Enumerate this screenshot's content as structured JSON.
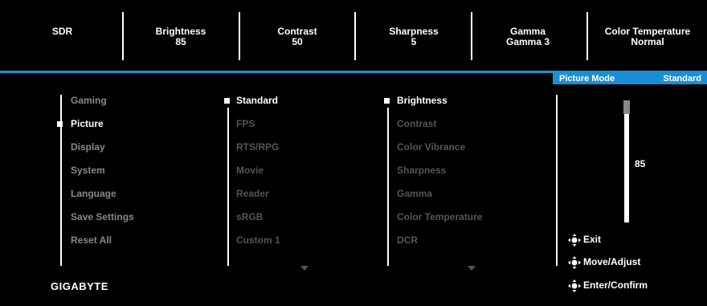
{
  "status_bar": {
    "sdr": "SDR",
    "brightness": {
      "label": "Brightness",
      "value": "85"
    },
    "contrast": {
      "label": "Contrast",
      "value": "50"
    },
    "sharpness": {
      "label": "Sharpness",
      "value": "5"
    },
    "gamma": {
      "label": "Gamma",
      "value": "Gamma 3"
    },
    "color_temp": {
      "label": "Color Temperature",
      "value": "Normal"
    }
  },
  "picture_mode": {
    "label": "Picture Mode",
    "value": "Standard"
  },
  "main_menu": [
    "Gaming",
    "Picture",
    "Display",
    "System",
    "Language",
    "Save Settings",
    "Reset All"
  ],
  "main_menu_selected": 1,
  "mode_menu": [
    "Standard",
    "FPS",
    "RTS/RPG",
    "Movie",
    "Reader",
    "sRGB",
    "Custom 1"
  ],
  "mode_menu_selected": 0,
  "setting_menu": [
    "Brightness",
    "Contrast",
    "Color Vibrance",
    "Sharpness",
    "Gamma",
    "Color Temperature",
    "DCR"
  ],
  "setting_menu_selected": 0,
  "slider": {
    "value": "85",
    "level_percent": 85
  },
  "hints": {
    "exit": "Exit",
    "move": "Move/Adjust",
    "enter": "Enter/Confirm"
  },
  "brand": "GIGABYTE",
  "colors": {
    "accent": "#1a8fd6",
    "dim": "#555555",
    "background": "#000000"
  }
}
